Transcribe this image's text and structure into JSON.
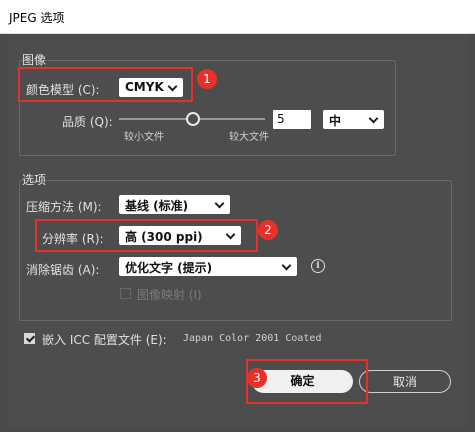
{
  "window": {
    "title": "JPEG 选项"
  },
  "image_group": {
    "title": "图像",
    "color_model_label": "颜色模型 (C):",
    "color_model_value": "CMYK",
    "quality_label": "品质 (Q):",
    "quality_value": "5",
    "quality_level": "中",
    "quality_min_label": "较小文件",
    "quality_max_label": "较大文件"
  },
  "options_group": {
    "title": "选项",
    "compression_label": "压缩方法 (M):",
    "compression_value": "基线 (标准)",
    "resolution_label": "分辨率 (R):",
    "resolution_value": "高 (300 ppi)",
    "antialias_label": "消除锯齿 (A):",
    "antialias_value": "优化文字 (提示)",
    "image_map_label": "图像映射 (I)"
  },
  "icc": {
    "label": "嵌入 ICC 配置文件 (E):",
    "profile": "Japan Color 2001 Coated"
  },
  "buttons": {
    "ok": "确定",
    "cancel": "取消"
  },
  "annotations": {
    "badge1": "1",
    "badge2": "2",
    "badge3": "3"
  },
  "colors": {
    "accent": "#e8302a",
    "dialog_bg": "#4d4d4d"
  }
}
